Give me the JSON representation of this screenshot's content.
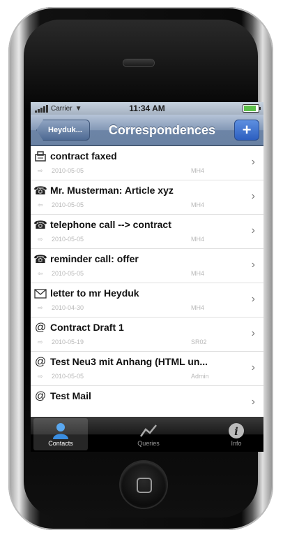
{
  "status": {
    "carrier": "Carrier",
    "time": "11:34 AM"
  },
  "nav": {
    "back_label": "Heyduk...",
    "title": "Correspondences",
    "add_label": "+"
  },
  "rows": [
    {
      "icon": "fax-icon",
      "title": "contract faxed",
      "date": "2010-05-05",
      "user": "MH4"
    },
    {
      "icon": "phone-icon",
      "title": "Mr. Musterman: Article xyz",
      "date": "2010-05-05",
      "user": "MH4"
    },
    {
      "icon": "phone-icon",
      "title": "telephone call --> contract",
      "date": "2010-05-05",
      "user": "MH4"
    },
    {
      "icon": "phone-icon",
      "title": "reminder call: offer",
      "date": "2010-05-05",
      "user": "MH4"
    },
    {
      "icon": "letter-icon",
      "title": "letter to mr Heyduk",
      "date": "2010-04-30",
      "user": "MH4"
    },
    {
      "icon": "email-icon",
      "title": "Contract Draft 1",
      "date": "2010-05-19",
      "user": "SR02"
    },
    {
      "icon": "email-icon",
      "title": "Test Neu3 mit Anhang (HTML un...",
      "date": "2010-05-05",
      "user": "Admin"
    },
    {
      "icon": "email-icon",
      "title": "Test Mail",
      "date": "",
      "user": ""
    }
  ],
  "tabs": [
    {
      "icon": "contacts-icon",
      "label": "Contacts",
      "active": true
    },
    {
      "icon": "queries-icon",
      "label": "Queries",
      "active": false
    },
    {
      "icon": "info-icon",
      "label": "Info",
      "active": false
    }
  ]
}
